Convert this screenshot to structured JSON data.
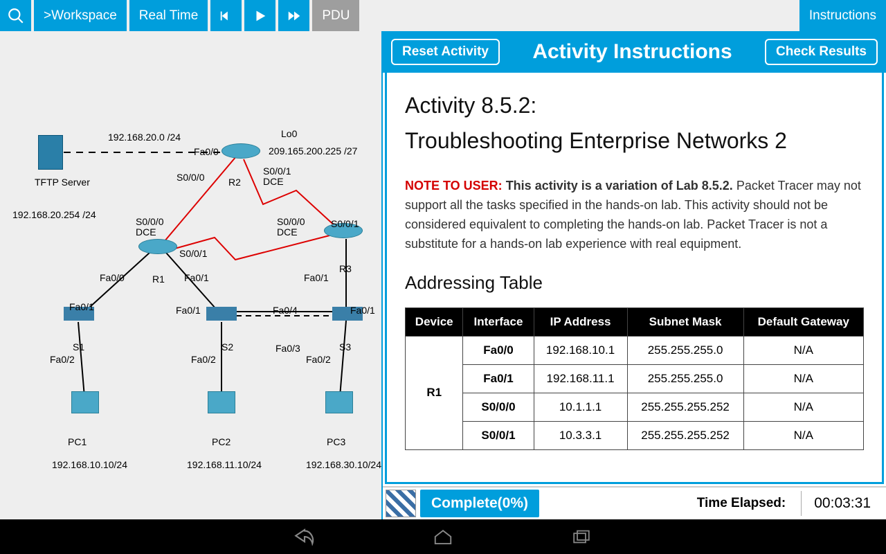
{
  "toolbar": {
    "workspace": ">Workspace",
    "realtime": "Real Time",
    "pdu": "PDU",
    "instructions": "Instructions"
  },
  "panel": {
    "reset": "Reset Activity",
    "title": "Activity Instructions",
    "check": "Check Results"
  },
  "activity": {
    "title_line1": "Activity 8.5.2:",
    "title_line2": "Troubleshooting Enterprise Networks 2",
    "note_prefix": "NOTE TO USER:",
    "note_bold": " This activity is a variation of Lab 8.5.2.",
    "note_rest": " Packet Tracer may not support all the tasks specified in the hands-on lab. This activity should not be considered equivalent to completing the hands-on lab. Packet Tracer is not a substitute for a hands-on lab experience with real equipment.",
    "addressing_heading": "Addressing Table"
  },
  "table": {
    "headers": [
      "Device",
      "Interface",
      "IP Address",
      "Subnet Mask",
      "Default Gateway"
    ],
    "rows": [
      {
        "device": "R1",
        "iface": "Fa0/0",
        "ip": "192.168.10.1",
        "mask": "255.255.255.0",
        "gw": "N/A"
      },
      {
        "device": "",
        "iface": "Fa0/1",
        "ip": "192.168.11.1",
        "mask": "255.255.255.0",
        "gw": "N/A"
      },
      {
        "device": "",
        "iface": "S0/0/0",
        "ip": "10.1.1.1",
        "mask": "255.255.255.252",
        "gw": "N/A"
      },
      {
        "device": "",
        "iface": "S0/0/1",
        "ip": "10.3.3.1",
        "mask": "255.255.255.252",
        "gw": "N/A"
      }
    ]
  },
  "footer": {
    "complete": "Complete(0%)",
    "elapsed_label": "Time Elapsed:",
    "elapsed_value": "00:03:31"
  },
  "topology": {
    "tftp_name": "TFTP Server",
    "tftp_ip": "192.168.20.254 /24",
    "net20": "192.168.20.0 /24",
    "lo0": "Lo0",
    "lo0_ip": "209.165.200.225 /27",
    "r1": "R1",
    "r2": "R2",
    "r3": "R3",
    "s1": "S1",
    "s2": "S2",
    "s3": "S3",
    "pc1": "PC1",
    "pc2": "PC2",
    "pc3": "PC3",
    "pc1_ip": "192.168.10.10/24",
    "pc2_ip": "192.168.11.10/24",
    "pc3_ip": "192.168.30.10/24",
    "fa00": "Fa0/0",
    "fa01": "Fa0/1",
    "fa02": "Fa0/2",
    "fa03": "Fa0/3",
    "fa04": "Fa0/4",
    "s000": "S0/0/0",
    "s001": "S0/0/1",
    "s000dce": "S0/0/0 DCE",
    "s001dce": "S0/0/1 DCE"
  }
}
